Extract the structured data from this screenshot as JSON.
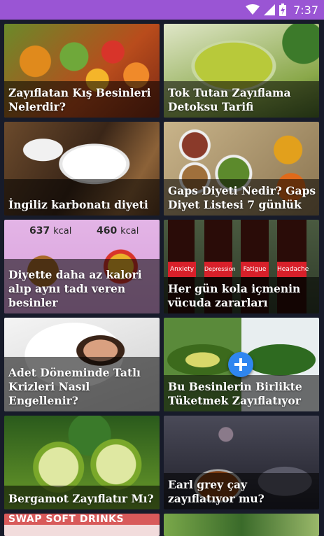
{
  "status_bar": {
    "time": "7:37",
    "icons": [
      "wifi-icon",
      "signal-icon",
      "battery-charging-icon"
    ]
  },
  "articles": [
    {
      "title": "Zayıflatan Kış Besinleri Nelerdir?"
    },
    {
      "title": "Tok Tutan Zayıflama Detoksu Tarifi"
    },
    {
      "title": "İngiliz karbonatı diyeti"
    },
    {
      "title": "Gaps Diyeti Nedir? Gaps Diyet Listesi 7 günlük"
    },
    {
      "title": "Diyette daha az kalori alıp aynı tadı veren besinler",
      "labels": {
        "left_value": "637",
        "left_unit": "kcal",
        "right_value": "460",
        "right_unit": "kcal"
      }
    },
    {
      "title": "Her gün kola içmenin vücuda zararları",
      "bottle_labels": [
        "Anxiety",
        "Depression",
        "Fatigue",
        "Headache"
      ]
    },
    {
      "title": "Adet Döneminde Tatlı Krizleri Nasıl Engellenir?"
    },
    {
      "title": "Bu Besinlerin Birlikte Tüketmek Zayıflatıyor"
    },
    {
      "title": "Bergamot Zayıflatır Mı?"
    },
    {
      "title": "Earl grey çay zayıflatıyor mu?"
    },
    {
      "title": "",
      "banner": "SWAP SOFT DRINKS"
    },
    {
      "title": ""
    }
  ],
  "fab": {
    "icon": "plus-icon"
  },
  "colors": {
    "status_bar": "#9a55d4",
    "background": "#171b2a",
    "fab": "#2f86f0"
  }
}
